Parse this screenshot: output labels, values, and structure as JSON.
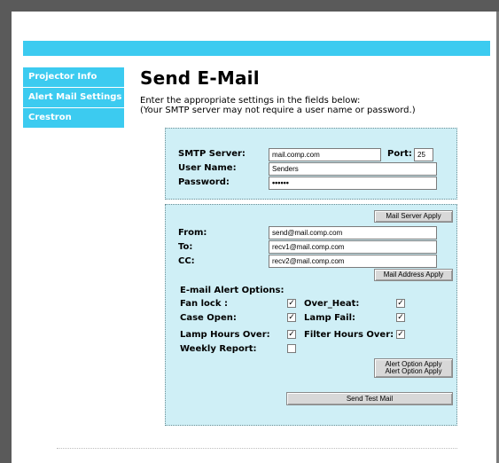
{
  "nav": {
    "items": [
      "Projector Info",
      "Alert Mail Settings",
      "Crestron"
    ]
  },
  "page": {
    "title": "Send E-Mail",
    "intro_line1": "Enter the appropriate settings in the fields below:",
    "intro_line2": "(Your SMTP server may not require a user name or password.)"
  },
  "server": {
    "smtp_label": "SMTP Server:",
    "smtp_value": "mail.comp.com",
    "port_label": "Port:",
    "port_value": "25",
    "user_label": "User Name:",
    "user_value": "Senders",
    "password_label": "Password:",
    "password_value": "••••••"
  },
  "addresses": {
    "server_apply_button": "Mail Server Apply",
    "from_label": "From:",
    "from_value": "send@mail.comp.com",
    "to_label": "To:",
    "to_value": "recv1@mail.comp.com",
    "cc_label": "CC:",
    "cc_value": "recv2@mail.comp.com",
    "address_apply_button": "Mail Address Apply"
  },
  "alerts": {
    "heading": "E-mail Alert Options:",
    "fan_lock": {
      "label": "Fan lock :",
      "checked": true
    },
    "over_heat": {
      "label": "Over_Heat:",
      "checked": true
    },
    "case_open": {
      "label": "Case Open:",
      "checked": true
    },
    "lamp_fail": {
      "label": "Lamp Fail:",
      "checked": true
    },
    "lamp_hours_over": {
      "label": "Lamp Hours Over:",
      "checked": true
    },
    "filter_hours_over": {
      "label": "Filter Hours Over:",
      "checked": true
    },
    "weekly_report": {
      "label": "Weekly Report:",
      "checked": false
    },
    "option_apply_line1": "Alert Option Apply",
    "option_apply_line2": "Alert Option Apply",
    "send_test_button": "Send Test Mail"
  },
  "glyphs": {
    "check": "✓"
  },
  "colors": {
    "accent": "#3ccbf0",
    "panel": "#cfeff6",
    "frame": "#5a5a5a"
  }
}
